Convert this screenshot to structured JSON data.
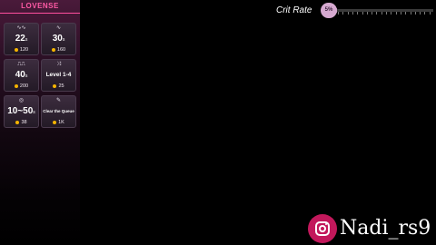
{
  "brand": {
    "name": "LOVENSE",
    "color": "#ff4e9e"
  },
  "cards": [
    {
      "icon": "wave-pulse-icon",
      "icon_glyph": "∿∿",
      "value": "22",
      "unit": "s",
      "cost": "120"
    },
    {
      "icon": "wave-curve-icon",
      "icon_glyph": "∿",
      "value": "30",
      "unit": "s",
      "cost": "160"
    },
    {
      "icon": "pulse-pattern-icon",
      "icon_glyph": "⎍⎍",
      "value": "40",
      "unit": "s",
      "cost": "200"
    },
    {
      "icon": "shuffle-icon",
      "icon_glyph": "⤨",
      "value": "Level 1-4",
      "unit": "",
      "cost": "25"
    },
    {
      "icon": "random-target-icon",
      "icon_glyph": "◎",
      "value": "10~50",
      "unit": "s",
      "cost": "38"
    },
    {
      "icon": "broom-icon",
      "icon_glyph": "✎",
      "value": "Clear the Queue",
      "unit": "",
      "cost": "1K"
    }
  ],
  "crit_rate": {
    "label": "Crit Rate",
    "value_label": "5%",
    "fraction": 0.05
  },
  "overlay": {
    "platform_icon": "instagram-icon",
    "handle": "Nadi_rs9"
  }
}
